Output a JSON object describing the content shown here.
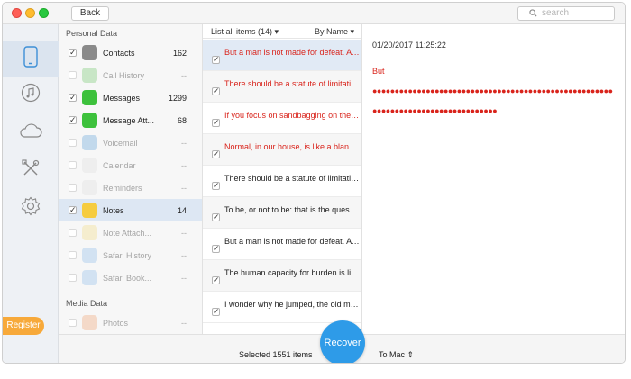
{
  "titlebar": {
    "back_label": "Back",
    "search_placeholder": "search"
  },
  "rail": {
    "items": [
      {
        "icon": "phone-icon"
      },
      {
        "icon": "music-icon"
      },
      {
        "icon": "cloud-icon"
      },
      {
        "icon": "tools-icon"
      },
      {
        "icon": "gear-icon"
      }
    ],
    "register_label": "Register"
  },
  "categories": {
    "personal_label": "Personal Data",
    "media_label": "Media Data",
    "items": [
      {
        "label": "Contacts",
        "count": "162",
        "checked": true,
        "enabled": true,
        "icon": "contacts-icon",
        "color": "#8a8a8a"
      },
      {
        "label": "Call History",
        "count": "--",
        "checked": false,
        "enabled": false,
        "icon": "phone-call-icon",
        "color": "#a9dba5"
      },
      {
        "label": "Messages",
        "count": "1299",
        "checked": true,
        "enabled": true,
        "icon": "messages-icon",
        "color": "#3dc13c"
      },
      {
        "label": "Message Att...",
        "count": "68",
        "checked": true,
        "enabled": true,
        "icon": "message-attachment-icon",
        "color": "#3dc13c"
      },
      {
        "label": "Voicemail",
        "count": "--",
        "checked": false,
        "enabled": false,
        "icon": "voicemail-icon",
        "color": "#9ec4e4"
      },
      {
        "label": "Calendar",
        "count": "--",
        "checked": false,
        "enabled": false,
        "icon": "calendar-icon",
        "color": "#e8e8e8"
      },
      {
        "label": "Reminders",
        "count": "--",
        "checked": false,
        "enabled": false,
        "icon": "reminders-icon",
        "color": "#e8e8e8"
      },
      {
        "label": "Notes",
        "count": "14",
        "checked": true,
        "enabled": true,
        "selected": true,
        "icon": "notes-icon",
        "color": "#f6cc3f"
      },
      {
        "label": "Note Attach...",
        "count": "--",
        "checked": false,
        "enabled": false,
        "icon": "note-attachment-icon",
        "color": "#f4e6b3"
      },
      {
        "label": "Safari History",
        "count": "--",
        "checked": false,
        "enabled": false,
        "icon": "safari-icon",
        "color": "#b9d3ee"
      },
      {
        "label": "Safari Book...",
        "count": "--",
        "checked": false,
        "enabled": false,
        "icon": "safari-bookmark-icon",
        "color": "#b9d3ee"
      },
      {
        "label": "Photos",
        "count": "--",
        "checked": false,
        "enabled": false,
        "icon": "photos-icon",
        "color": "#f2c4a8"
      }
    ]
  },
  "list": {
    "header_left": "List all items (14)",
    "header_right": "By Name",
    "rows": [
      {
        "text": "But a man is not made for defeat. A man can be destroyed but not defeated.",
        "red": true,
        "selected": true
      },
      {
        "text": "There should be a statute of limitations on regret.",
        "red": true
      },
      {
        "text": "If you focus on sandbagging on the job.",
        "red": true
      },
      {
        "text": "Normal, in our house, is like a blanket.",
        "red": true
      },
      {
        "text": "There should be a statute of limitations on regret.",
        "red": false
      },
      {
        "text": "To be, or not to be: that is the question.",
        "red": false
      },
      {
        "text": "But a man is not made for defeat. A man can be destroyed.",
        "red": false
      },
      {
        "text": "The human capacity for burden is like bamboo.",
        "red": false
      },
      {
        "text": "I wonder why he jumped, the old man said.",
        "red": false
      }
    ]
  },
  "detail": {
    "date": "01/20/2017 11:25:22",
    "line1": "But",
    "dots": "●●●●●●●●●●●●●●●●●●●●●●●●●●●●●●●●●●●●●●●●●●●●●●●●●●●●●●●●●●●●●●●●●●●●●●●●●●●●●●●●●●"
  },
  "bottom": {
    "selected_text": "Selected 1551 items",
    "recover_label": "Recover",
    "destination": "To Mac ⇕"
  },
  "colors": {
    "accent": "#2e9be8",
    "register": "#f7a93a",
    "red_text": "#d9241c"
  }
}
